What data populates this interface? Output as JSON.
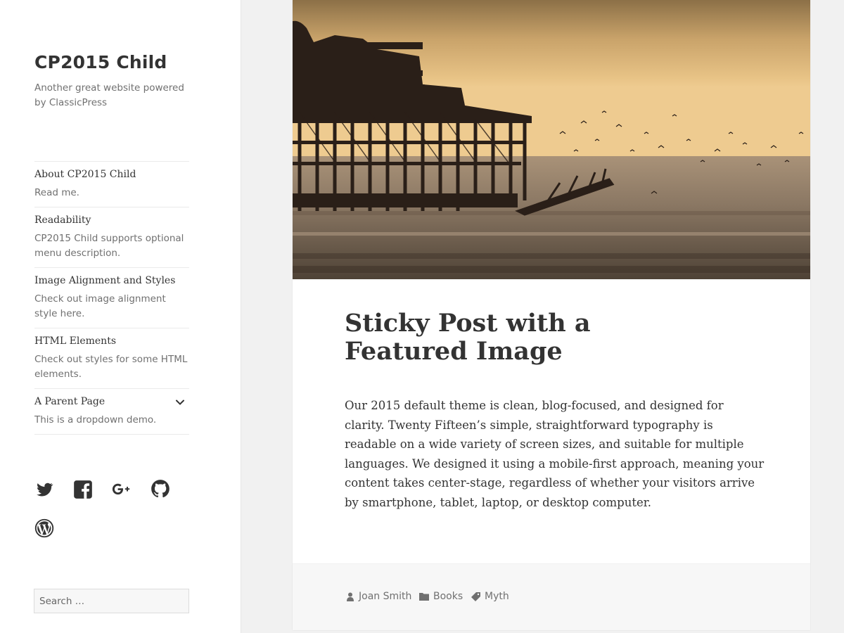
{
  "site": {
    "title": "CP2015 Child",
    "description": "Another great website powered by ClassicPress"
  },
  "menu": [
    {
      "title": "About CP2015 Child",
      "description": "Read me."
    },
    {
      "title": "Readability",
      "description": "CP2015 Child supports optional menu description."
    },
    {
      "title": "Image Alignment and Styles",
      "description": "Check out image alignment style here."
    },
    {
      "title": "HTML Elements",
      "description": "Check out styles for some HTML elements."
    },
    {
      "title": "A Parent Page",
      "description": "This is a dropdown demo.",
      "has_children": true
    }
  ],
  "social": [
    "twitter-icon",
    "facebook-icon",
    "google-plus-icon",
    "github-icon",
    "wordpress-icon"
  ],
  "search": {
    "placeholder": "Search …"
  },
  "post": {
    "title": "Sticky Post with a Featured Image",
    "content": "Our 2015 default theme is clean, blog-focused, and designed for clarity. Twenty Fifteen’s simple, straightforward typography is readable on a wide variety of screen sizes, and suitable for multiple languages. We designed it using a mobile-first approach, meaning your content takes center-stage, regardless of whether your visitors arrive by smartphone, tablet, laptop, or desktop computer.",
    "author": "Joan Smith",
    "category": "Books",
    "tag": "Myth"
  },
  "colors": {
    "accent": "#333333",
    "muted": "#707070",
    "background": "#f1f1f1"
  }
}
